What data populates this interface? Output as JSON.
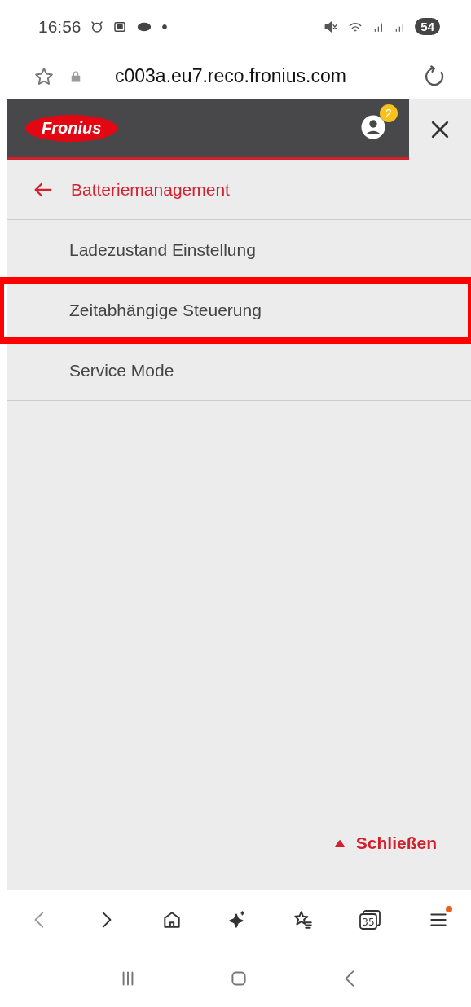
{
  "status_bar": {
    "time": "16:56",
    "battery": "54"
  },
  "address_bar": {
    "url": "c003a.eu7.reco.fronius.com"
  },
  "header": {
    "logo": "Fronius",
    "notification_count": "2"
  },
  "menu": {
    "back_label": "Batteriemanagement",
    "items": [
      {
        "label": "Ladezustand Einstellung",
        "highlighted": false
      },
      {
        "label": "Zeitabhängige Steuerung",
        "highlighted": true
      },
      {
        "label": "Service Mode",
        "highlighted": false
      }
    ],
    "close_label": "Schließen"
  },
  "browser_toolbar": {
    "tabs_count": "35",
    "menu_badge": true
  }
}
